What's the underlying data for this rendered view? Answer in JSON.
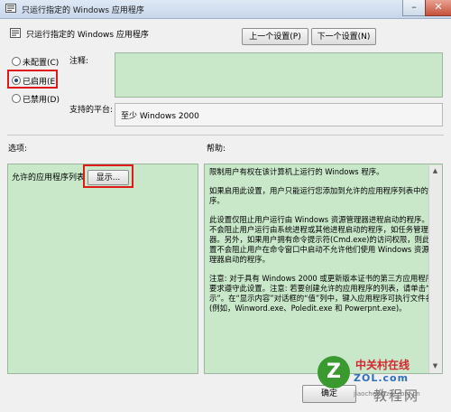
{
  "window": {
    "title": "只运行指定的 Windows 应用程序"
  },
  "header": {
    "title": "只运行指定的 Windows 应用程序"
  },
  "nav": {
    "prev_label": "上一个设置(P)",
    "next_label": "下一个设置(N)"
  },
  "state": {
    "options": [
      "未配置(C)",
      "已启用(E)",
      "已禁用(D)"
    ],
    "selected": "已启用(E)"
  },
  "comment": {
    "label": "注释:",
    "value": ""
  },
  "platform": {
    "label": "支持的平台:",
    "value": "至少 Windows 2000"
  },
  "options_section": {
    "label": "选项:",
    "list_label": "允许的应用程序列表",
    "show_button": "显示..."
  },
  "help_section": {
    "label": "帮助:",
    "paragraphs": [
      "限制用户有权在该计算机上运行的 Windows 程序。",
      "如果启用此设置，用户只能运行您添加到允许的应用程序列表中的程序。",
      "此设置仅阻止用户运行由 Windows 资源管理器进程启动的程序。它不会阻止用户运行由系统进程或其他进程启动的程序，如任务管理器。另外，如果用户拥有命令提示符(Cmd.exe)的访问权限，则此设置不会阻止用户在命令窗口中启动不允许他们使用 Windows 资源管理器启动的程序。",
      "注意: 对于具有 Windows 2000 或更新版本证书的第三方应用程序，要求遵守此设置。注意: 若要创建允许的应用程序的列表，请单击“显示”。在“显示内容”对话框的“值”列中，键入应用程序可执行文件名(例如，Winword.exe、Poledit.exe 和 Powerpnt.exe)。"
    ]
  },
  "footer": {
    "ok_label": "确定"
  },
  "watermark": {
    "brand": "中关村在线",
    "domain": "ZOL.com",
    "chinese": "教程网",
    "sub": "jiaocheng.zol.com.cn"
  },
  "colors": {
    "panel_green": "#c9e8ca",
    "highlight_red": "#e01a1a",
    "watermark_green": "#3a9a2f"
  }
}
